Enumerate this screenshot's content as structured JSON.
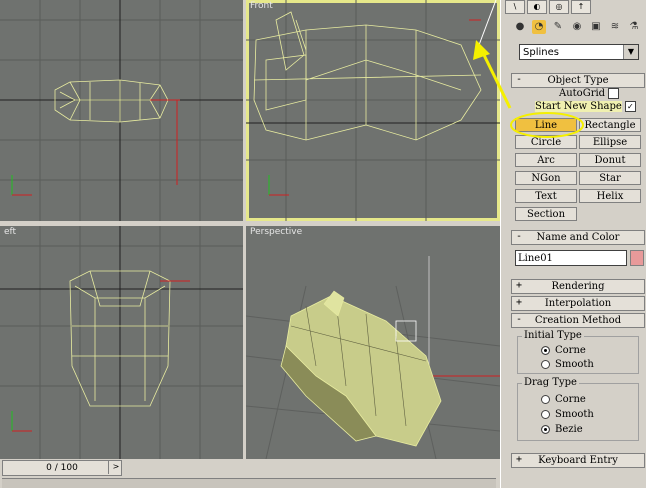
{
  "viewports": {
    "top_label": "",
    "front_label": "Front",
    "left_label": "eft",
    "perspective_label": "Perspective"
  },
  "timebar": {
    "frame_text": "0 / 100",
    "arrow": ">"
  },
  "panel": {
    "tabs": [
      "\\",
      "◐",
      "◎",
      "↑"
    ],
    "categories": [
      "●",
      "◔",
      "✎",
      "◉",
      "▣",
      "≋",
      "⚗"
    ],
    "dropdown_value": "Splines",
    "object_type": {
      "title": "Object Type",
      "sign": "-",
      "autogrid_label": "AutoGrid",
      "start_new_shape_label": "Start New Shape",
      "buttons": [
        "Line",
        "Rectangle",
        "Circle",
        "Ellipse",
        "Arc",
        "Donut",
        "NGon",
        "Star",
        "Text",
        "Helix",
        "Section"
      ]
    },
    "name_color": {
      "title": "Name and Color",
      "sign": "-",
      "name_value": "Line01"
    },
    "rendering": {
      "title": "Rendering",
      "sign": "+"
    },
    "interpolation": {
      "title": "Interpolation",
      "sign": "+"
    },
    "creation_method": {
      "title": "Creation Method",
      "sign": "-",
      "initial_type": {
        "title": "Initial Type",
        "options": [
          "Corne",
          "Smooth"
        ],
        "selected": "Corne"
      },
      "drag_type": {
        "title": "Drag Type",
        "options": [
          "Corne",
          "Smooth",
          "Bezie"
        ],
        "selected": "Bezie"
      }
    },
    "keyboard_entry": {
      "title": "Keyboard Entry",
      "sign": "+"
    }
  },
  "colors": {
    "active_button": "#f0c040",
    "wireframe": "#e8eca0",
    "highlight": "#f5f000",
    "viewport_bg": "#6f726f"
  }
}
